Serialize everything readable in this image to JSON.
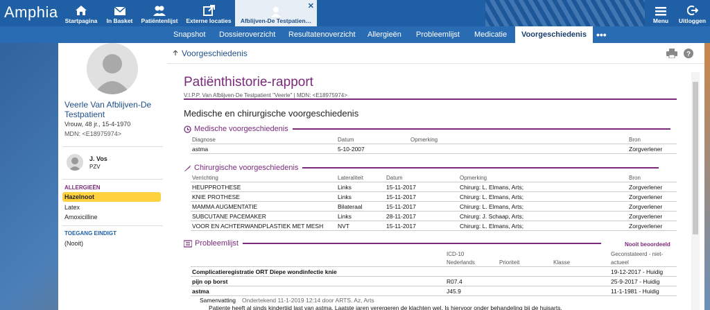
{
  "app": {
    "logo": "Amphia"
  },
  "topnav": [
    {
      "label": "Startpagina",
      "icon": "home-icon"
    },
    {
      "label": "In Basket",
      "icon": "mail-icon"
    },
    {
      "label": "Patiëntenlijst",
      "icon": "people-icon"
    },
    {
      "label": "Externe locaties",
      "icon": "external-icon"
    }
  ],
  "active_tab": {
    "label": "Afblijven-De Testpatien…",
    "close": "✕"
  },
  "right_nav": [
    {
      "label": "Menu",
      "icon": "menu-icon"
    },
    {
      "label": "Uitloggen",
      "icon": "logout-icon"
    }
  ],
  "subnav": [
    "Snapshot",
    "Dossieroverzicht",
    "Resultatenoverzicht",
    "Allergieën",
    "Probleemlijst",
    "Medicatie",
    "Voorgeschiedenis"
  ],
  "subnav_more": "•••",
  "patient": {
    "name": "Veerle Van Afblijven-De Testpatient",
    "info": "Vrouw, 48 jr., 15-4-1970",
    "mdn": "MDN: <E18975974>"
  },
  "doctor": {
    "name": "J. Vos",
    "role": "PZV"
  },
  "allergies": {
    "heading": "ALLERGIEËN",
    "items": [
      "Hazelnoot",
      "Latex",
      "Amoxicilline"
    ]
  },
  "access": {
    "heading": "TOEGANG EINDIGT",
    "value": "(Nooit)"
  },
  "main": {
    "title": "Voorgeschiedenis"
  },
  "report": {
    "title": "Patiënthistorie-rapport",
    "subtitle": "V.I.P.P. Van Afblijven-De Testpatient \"Veerle\" | MDN: <E18975974>",
    "section_title": "Medische en chirurgische voorgeschiedenis",
    "med": {
      "heading": "Medische voorgeschiedenis",
      "cols": [
        "Diagnose",
        "Datum",
        "Opmerking",
        "Bron"
      ],
      "rows": [
        [
          "astma",
          "5-10-2007",
          "",
          "Zorgverlener"
        ]
      ]
    },
    "surg": {
      "heading": "Chirurgische voorgeschiedenis",
      "cols": [
        "Verrichting",
        "Lateraliteit",
        "Datum",
        "Opmerking",
        "Bron"
      ],
      "rows": [
        [
          "HEUPPROTHESE",
          "Links",
          "15-11-2017",
          "Chirurg: L. Elmans, Arts;",
          "Zorgverlener"
        ],
        [
          "KNIE PROTHESE",
          "Links",
          "15-11-2017",
          "Chirurg: L. Elmans, Arts;",
          "Zorgverlener"
        ],
        [
          "MAMMA AUGMENTATIE",
          "Bilateraal",
          "15-11-2017",
          "Chirurg: L. Elmans, Arts;",
          "Zorgverlener"
        ],
        [
          "SUBCUTANE PACEMAKER",
          "Links",
          "28-11-2017",
          "Chirurg: J. Schaap, Arts;",
          "Zorgverlener"
        ],
        [
          "VOOR EN ACHTERWANDPLASTIEK MET MESH",
          "NVT",
          "15-11-2017",
          "Chirurg: L. Elmans, Arts;",
          "Zorgverlener"
        ]
      ]
    },
    "prob": {
      "heading": "Probleemlijst",
      "status": "Nooit beoordeeld",
      "cols": [
        "ICD-10",
        "Nederlands",
        "Prioriteit",
        "Klasse",
        "Geconstateerd - niet-",
        "actueel"
      ],
      "rows": [
        [
          "Complicatieregistratie ORT Diepe wondinfectie knie",
          "",
          "19-12-2017 - Huidig"
        ],
        [
          "pijn op borst",
          "R07.4",
          "25-9-2017 - Huidig"
        ],
        [
          "astma",
          "J45.9",
          "11-1-1981 - Huidig"
        ]
      ],
      "summary_label": "Samenvatting",
      "summary_meta": "Ondertekend 11-1-2019 12:14 door ARTS. Az, Arts",
      "summary_text": "Patiente heeft al sinds kindertijd last van astma. Laatste jaren verergeren de klachten wel. Is hiervoor onder behandeling bij de huisarts."
    }
  }
}
